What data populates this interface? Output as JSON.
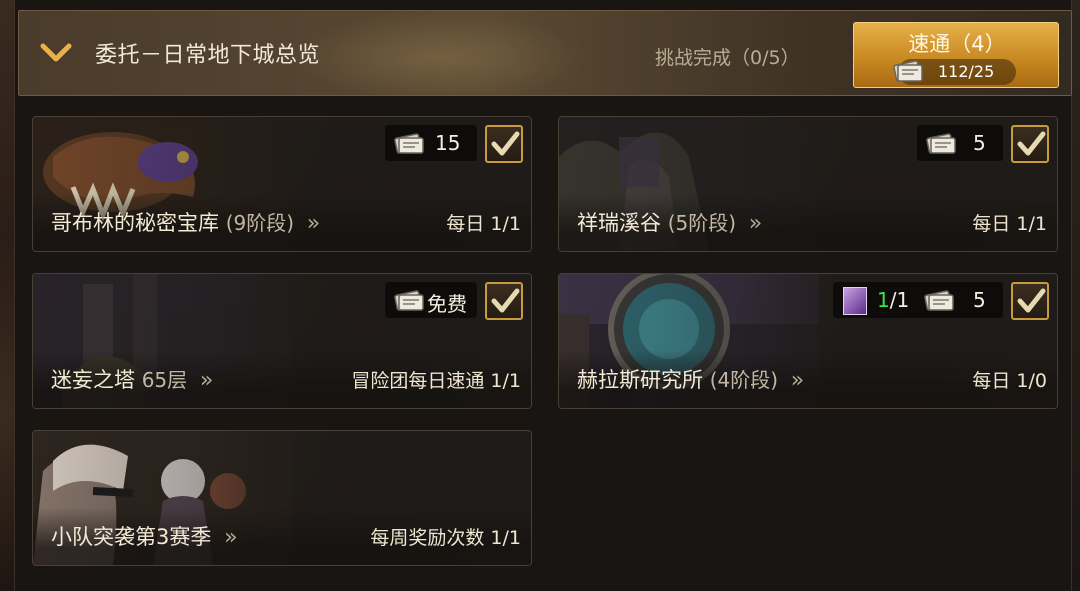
{
  "header": {
    "title": "委托－日常地下城总览",
    "progress_text": "挑战完成（0/5）",
    "quick_button": {
      "label": "速通（4）",
      "count": "112/25"
    }
  },
  "icons": {
    "collapse": "chevron-down-icon",
    "ticket": "ticket-icon",
    "check": "checkbox-checked-icon",
    "arrows": "double-chevron-right-icon",
    "item": "purple-item-icon"
  },
  "colors": {
    "accent": "#c98a23",
    "check_border": "#c99a3e",
    "green": "#3fe24b"
  },
  "cards": [
    {
      "name": "哥布林的秘密宝库",
      "stage": "(9阶段)",
      "arrows": "»",
      "cost": "15",
      "limit": "每日 1/1",
      "checked": true
    },
    {
      "name": "祥瑞溪谷",
      "stage": "(5阶段)",
      "arrows": "»",
      "cost": "5",
      "limit": "每日 1/1",
      "checked": true
    },
    {
      "name": "迷妄之塔",
      "stage": "65层",
      "arrows": "»",
      "cost": "免费",
      "limit": "冒险团每日速通 1/1",
      "checked": true
    },
    {
      "name": "赫拉斯研究所",
      "stage": "(4阶段)",
      "arrows": "»",
      "item_count_highlight": "1",
      "item_count_rest": "/1",
      "cost": "5",
      "limit": "每日 1/0",
      "checked": true
    },
    {
      "name": "小队突袭第3赛季",
      "stage": "",
      "arrows": "»",
      "limit": "每周奖励次数 1/1"
    }
  ]
}
